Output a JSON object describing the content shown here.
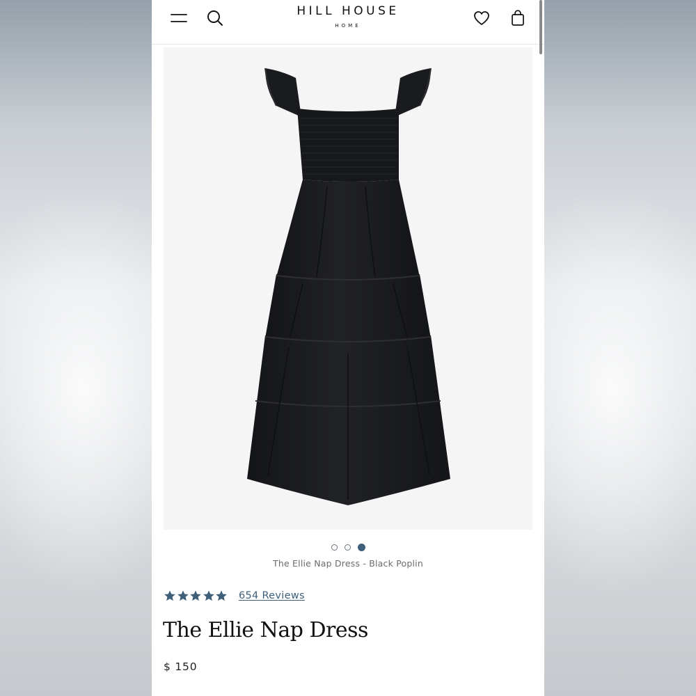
{
  "header": {
    "logo_main": "HILL HOUSE",
    "logo_sub": "HOME",
    "icons": [
      "menu-icon",
      "search-icon",
      "heart-icon",
      "shopping-bag-icon"
    ]
  },
  "gallery": {
    "image_subject": "black tiered smocked midi dress",
    "dot_count": 3,
    "active_dot": 3,
    "caption": "The Ellie Nap Dress - Black Poplin"
  },
  "product": {
    "rating": 5,
    "reviews_label": "654 Reviews",
    "title": "The Ellie Nap Dress",
    "price": "$ 150"
  },
  "colors": {
    "accent": "#3e5f7a",
    "star": "#3e5f7a",
    "image_background": "#f5f5f6",
    "dress": "#1b1c1f"
  }
}
